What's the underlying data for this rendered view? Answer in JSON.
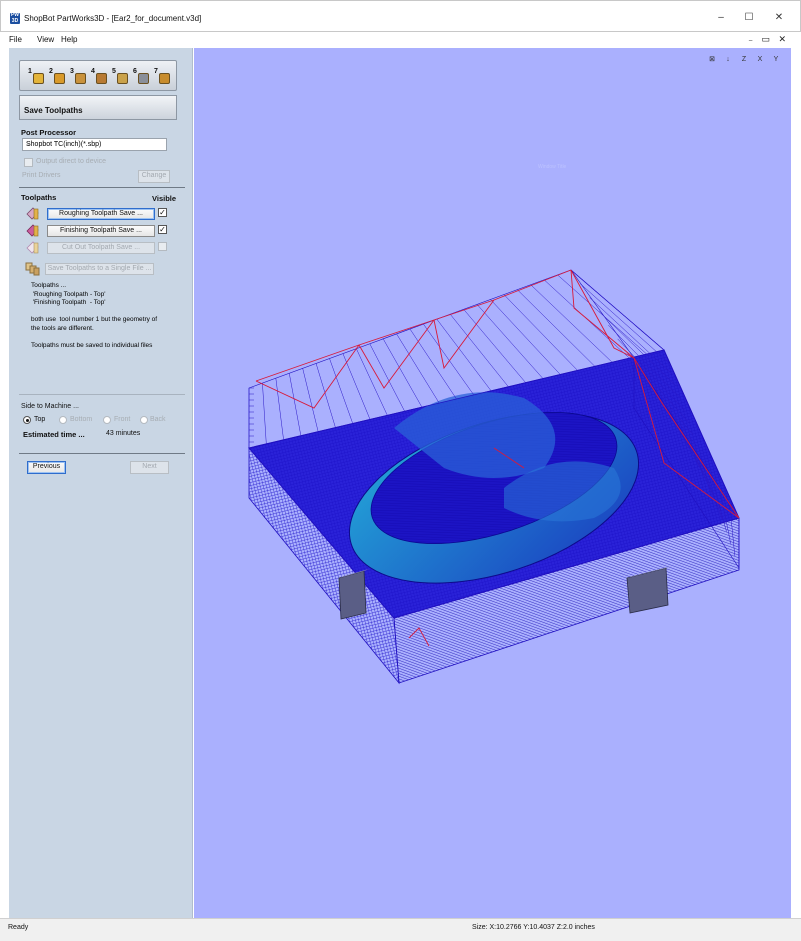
{
  "window": {
    "app_icon_text": "PW\n3D",
    "title": "ShopBot PartWorks3D - [Ear2_for_document.v3d]",
    "minimize": "–",
    "maximize": "☐",
    "close": "✕"
  },
  "menu": {
    "items": [
      "File",
      "View",
      "Help"
    ],
    "mdi_controls": "₋ ▭ ✕"
  },
  "panel": {
    "toolbar_steps": [
      {
        "num": "1",
        "icon": "open-model-icon",
        "color": "#e3b43a"
      },
      {
        "num": "2",
        "icon": "position-model-icon",
        "color": "#d99a2a"
      },
      {
        "num": "3",
        "icon": "material-setup-icon",
        "color": "#c9923c"
      },
      {
        "num": "4",
        "icon": "roughing-icon",
        "color": "#b87a32"
      },
      {
        "num": "5",
        "icon": "finishing-icon",
        "color": "#caa24a"
      },
      {
        "num": "6",
        "icon": "preview-icon",
        "color": "#8a8f99"
      },
      {
        "num": "7",
        "icon": "save-icon",
        "color": "#c88c2c"
      }
    ],
    "section_title": "Save Toolpaths",
    "post_processor_label": "Post Processor",
    "post_processor_value": "Shopbot TC(inch)(*.sbp)",
    "output_direct_label": "Output direct to device",
    "print_drivers_label": "Print Drivers",
    "change_label": "Change",
    "toolpaths_label": "Toolpaths",
    "visible_label": "Visible",
    "toolpath_buttons": [
      {
        "label": "Roughing Toolpath Save ...",
        "checked": "✓"
      },
      {
        "label": "Finishing Toolpath Save ...",
        "checked": "✓"
      },
      {
        "label": "Cut Out Toolpath Save ...",
        "checked": ""
      }
    ],
    "save_single_label": "Save Toolpaths to a Single File ...",
    "info_lines": [
      "Toolpaths ...",
      " 'Roughing Toolpath - Top'",
      " 'Finishing Toolpath  - Top'",
      "",
      "both use  tool number 1 but the geometry of",
      "the tools are different.",
      "",
      "Toolpaths must be saved to individual files"
    ],
    "side_to_machine_label": "Side to Machine ...",
    "sides": [
      {
        "label": "Top",
        "selected": true
      },
      {
        "label": "Bottom",
        "selected": false
      },
      {
        "label": "Front",
        "selected": false
      },
      {
        "label": "Back",
        "selected": false
      }
    ],
    "estimated_time_label": "Estimated time ...",
    "estimated_time_value": "43 minutes",
    "previous_label": "Previous",
    "next_label": "Next"
  },
  "viewport": {
    "background": "#aab0fe",
    "view_icons": [
      "zoom-extents-icon",
      "iso-view-icon",
      "z-view-icon",
      "x-view-icon",
      "y-view-icon"
    ],
    "view_icon_labels": [
      "⊠",
      "↓",
      "Z",
      "X",
      "Y"
    ],
    "watermark": "Window Title"
  },
  "status": {
    "left": "Ready",
    "center": "Size: X:10.2766 Y:10.4037 Z:2.0 inches"
  }
}
